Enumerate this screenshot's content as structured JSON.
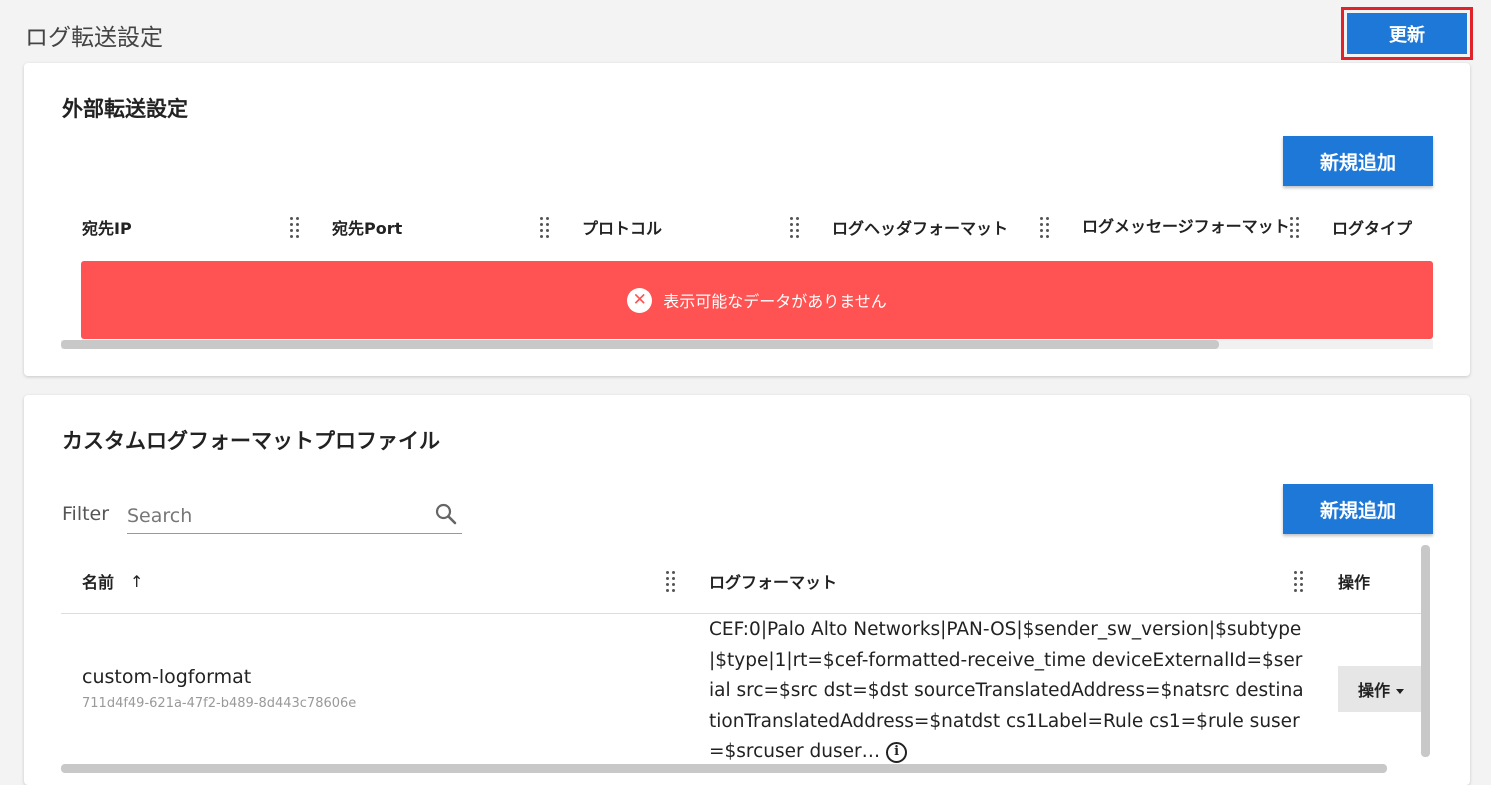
{
  "page": {
    "title": "ログ転送設定",
    "refresh_label": "更新"
  },
  "forwarding": {
    "title": "外部転送設定",
    "add_label": "新規追加",
    "columns": [
      "宛先IP",
      "宛先Port",
      "プロトコル",
      "ログヘッダフォーマット",
      "ログメッセージフォーマット",
      "ログタイプ"
    ],
    "empty_message": "表示可能なデータがありません"
  },
  "profiles": {
    "title": "カスタムログフォーマットプロファイル",
    "filter_label": "Filter",
    "search_placeholder": "Search",
    "add_label": "新規追加",
    "columns": {
      "name": "名前",
      "format": "ログフォーマット",
      "actions": "操作"
    },
    "sort_indicator": "↑",
    "rows": [
      {
        "name": "custom-logformat",
        "id": "711d4f49-621a-47f2-b489-8d443c78606e",
        "format": "CEF:0|Palo Alto Networks|PAN-OS|$sender_sw_version|$subtype|$type|1|rt=$cef-formatted-receive_time deviceExternalId=$serial src=$src dst=$dst sourceTranslatedAddress=$natsrc destinationTranslatedAddress=$natdst cs1Label=Rule cs1=$rule suser=$srcuser duser…",
        "action_label": "操作"
      }
    ]
  },
  "colors": {
    "primary": "#1e78d7",
    "error": "#ff5252",
    "highlight": "#e0222b"
  }
}
